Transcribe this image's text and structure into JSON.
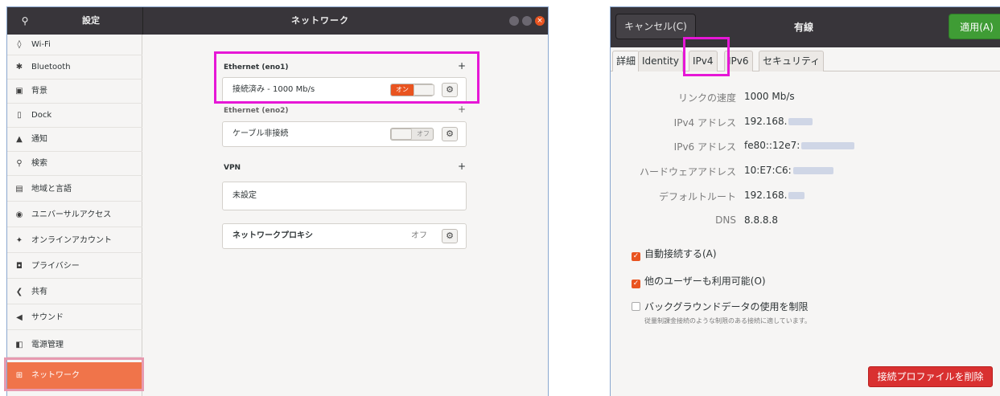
{
  "settings_window": {
    "sidebar_title": "設定",
    "main_title": "ネットワーク",
    "search_icon": "search-icon",
    "sidebar_items": [
      {
        "icon": "wifi-icon",
        "glyph": "📶",
        "label": "Wi-Fi"
      },
      {
        "icon": "bluetooth-icon",
        "glyph": "✱",
        "label": "Bluetooth"
      },
      {
        "icon": "background-icon",
        "glyph": "▣",
        "label": "背景"
      },
      {
        "icon": "dock-icon",
        "glyph": "▯",
        "label": "Dock"
      },
      {
        "icon": "bell-icon",
        "glyph": "▲",
        "label": "通知"
      },
      {
        "icon": "search-icon",
        "glyph": "⚲",
        "label": "検索"
      },
      {
        "icon": "region-icon",
        "glyph": "▤",
        "label": "地域と言語"
      },
      {
        "icon": "accessibility-icon",
        "glyph": "◉",
        "label": "ユニバーサルアクセス"
      },
      {
        "icon": "online-accounts-icon",
        "glyph": "✦",
        "label": "オンラインアカウント"
      },
      {
        "icon": "privacy-icon",
        "glyph": "◘",
        "label": "プライバシー"
      },
      {
        "icon": "share-icon",
        "glyph": "❮",
        "label": "共有"
      },
      {
        "icon": "sound-icon",
        "glyph": "◀",
        "label": "サウンド"
      },
      {
        "icon": "power-icon",
        "glyph": "◧",
        "label": "電源管理"
      },
      {
        "icon": "network-icon",
        "glyph": "⊞",
        "label": "ネットワーク",
        "active": true
      }
    ],
    "ethernet1": {
      "title": "Ethernet (eno1)",
      "status": "接続済み - 1000 Mb/s",
      "toggle_label": "オン",
      "toggle_on": true
    },
    "ethernet2": {
      "title": "Ethernet (eno2)",
      "status": "ケーブル非接続",
      "toggle_label": "オフ",
      "toggle_on": false
    },
    "vpn": {
      "title": "VPN",
      "status": "未設定"
    },
    "proxy": {
      "title": "ネットワークプロキシ",
      "value": "オフ"
    },
    "add_symbol": "+"
  },
  "wired_dialog": {
    "cancel_label": "キャンセル(C)",
    "title": "有線",
    "apply_label": "適用(A)",
    "tabs": [
      "詳細",
      "Identity",
      "IPv4",
      "IPv6",
      "セキュリティ"
    ],
    "selected_tab": "詳細",
    "details": [
      {
        "key": "リンクの速度",
        "value": "1000 Mb/s"
      },
      {
        "key": "IPv4 アドレス",
        "value": "192.168."
      },
      {
        "key": "IPv6 アドレス",
        "value": "fe80::12e7:"
      },
      {
        "key": "ハードウェアアドレス",
        "value": "10:E7:C6:"
      },
      {
        "key": "デフォルトルート",
        "value": "192.168."
      },
      {
        "key": "DNS",
        "value": "8.8.8.8"
      }
    ],
    "auto_connect_label": "自動接続する(A)",
    "auto_connect_checked": true,
    "all_users_label": "他のユーザーも利用可能(O)",
    "all_users_checked": true,
    "restrict_bg_label": "バックグラウンドデータの使用を制限",
    "restrict_bg_checked": false,
    "restrict_bg_note": "従量制課金接続のような制限のある接続に適しています。",
    "delete_label": "接続プロファイルを削除"
  },
  "colors": {
    "accent": "#e95420",
    "apply_green": "#3f9c35",
    "delete_red": "#d93030",
    "highlight": "#e617d6"
  }
}
